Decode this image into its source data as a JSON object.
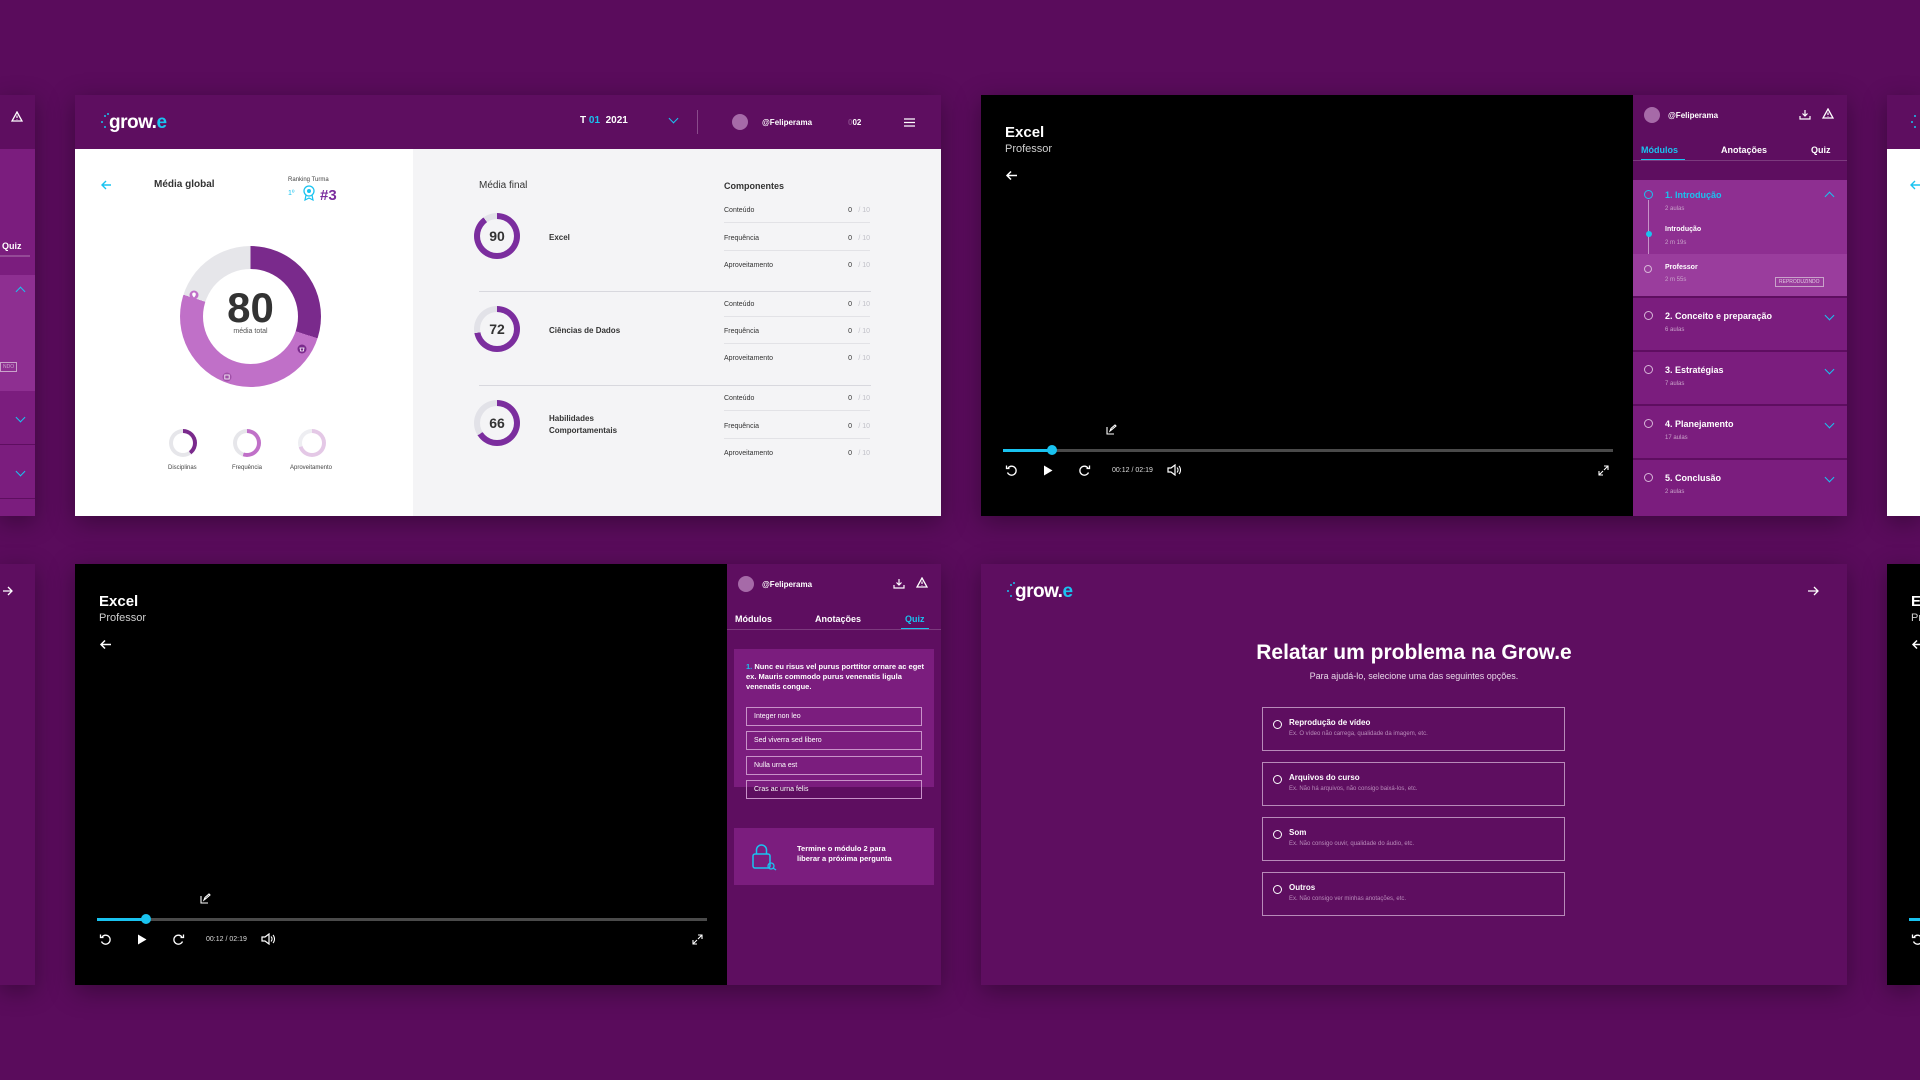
{
  "colors": {
    "background": "#5a0c5c",
    "panel": "#5e0e60",
    "accent": "#19c3f0",
    "module": "#7b1d7e"
  },
  "left_partial": {
    "quiz_tab": "Quiz",
    "playing_badge": "NDO"
  },
  "dashboard": {
    "logo": "grow.",
    "logo_e": "e",
    "term_prefix": "T",
    "term_num": "01",
    "year": "2021",
    "username": "@Feliperama",
    "notif_prefix": "0",
    "notif_count": "02",
    "global_title": "Média global",
    "ranking_label": "Ranking Turma",
    "ranking_badge": "1º",
    "ranking_value": "#3",
    "total_score": "80",
    "total_label": "média total",
    "mini_labels": [
      "Disciplinas",
      "Frequência",
      "Aproveitamento"
    ],
    "final_title": "Média final",
    "components_title": "Componentes",
    "subjects": [
      {
        "score": "90",
        "score_num": 90,
        "name": "Excel",
        "rows": [
          [
            "Conteúdo",
            "0",
            "/ 10"
          ],
          [
            "Frequência",
            "0",
            "/ 10"
          ],
          [
            "Aproveitamento",
            "0",
            "/ 10"
          ]
        ]
      },
      {
        "score": "72",
        "score_num": 72,
        "name": "Ciências de Dados",
        "rows": [
          [
            "Conteúdo",
            "0",
            "/ 10"
          ],
          [
            "Frequência",
            "0",
            "/ 10"
          ],
          [
            "Aproveitamento",
            "0",
            "/ 10"
          ]
        ]
      },
      {
        "score": "66",
        "score_num": 66,
        "name1": "Habilidades",
        "name2": "Comportamentais",
        "rows": [
          [
            "Conteúdo",
            "0",
            "/ 10"
          ],
          [
            "Frequência",
            "0",
            "/ 10"
          ],
          [
            "Aproveitamento",
            "0",
            "/ 10"
          ]
        ]
      }
    ]
  },
  "player_modules": {
    "title": "Excel",
    "subtitle": "Professor",
    "time": "00:12 / 02:19",
    "progress": 0.08,
    "username": "@Feliperama",
    "tabs": [
      "Módulos",
      "Anotações",
      "Quiz"
    ],
    "modules": [
      {
        "title": "1. Introdução",
        "sub": "2 aulas"
      },
      {
        "title": "2. Conceito e preparação",
        "sub": "6 aulas"
      },
      {
        "title": "3. Estratégias",
        "sub": "7 aulas"
      },
      {
        "title": "4. Planejamento",
        "sub": "17 aulas"
      },
      {
        "title": "5. Conclusão",
        "sub": "2 aulas"
      }
    ],
    "lessons": [
      {
        "title": "Introdução",
        "sub": "2 m 19s"
      },
      {
        "title": "Professor",
        "sub": "2 m 55s",
        "badge": "REPRODUZINDO"
      }
    ]
  },
  "player_quiz": {
    "title": "Excel",
    "subtitle": "Professor",
    "time": "00:12 / 02:19",
    "progress": 0.08,
    "username": "@Feliperama",
    "tabs": [
      "Módulos",
      "Anotações",
      "Quiz"
    ],
    "question_num": "1.",
    "question": "Nunc eu risus vel purus porttitor ornare ac eget ex. Mauris commodo purus venenatis ligula venenatis congue.",
    "options": [
      "Integer non leo",
      "Sed viverra sed libero",
      "Nulla urna est",
      "Cras ac urna felis"
    ],
    "locked": "Termine o módulo 2 para liberar a próxima pergunta"
  },
  "report": {
    "logo": "grow.",
    "logo_e": "e",
    "title": "Relatar um problema na Grow.e",
    "subtitle": "Para ajudá-lo, selecione uma das seguintes opções.",
    "options": [
      {
        "title": "Reprodução de vídeo",
        "desc": "Ex. O vídeo não carrega, qualidade da imagem, etc."
      },
      {
        "title": "Arquivos do curso",
        "desc": "Ex. Não há arquivos, não consigo baixá-los, etc."
      },
      {
        "title": "Som",
        "desc": "Ex. Não consigo ouvir, qualidade do áudio, etc."
      },
      {
        "title": "Outros",
        "desc": "Ex. Não consigo ver minhas anotações, etc."
      }
    ]
  },
  "right_partial_bottom": {
    "title_initial": "E",
    "sub_initial": "Pr"
  }
}
